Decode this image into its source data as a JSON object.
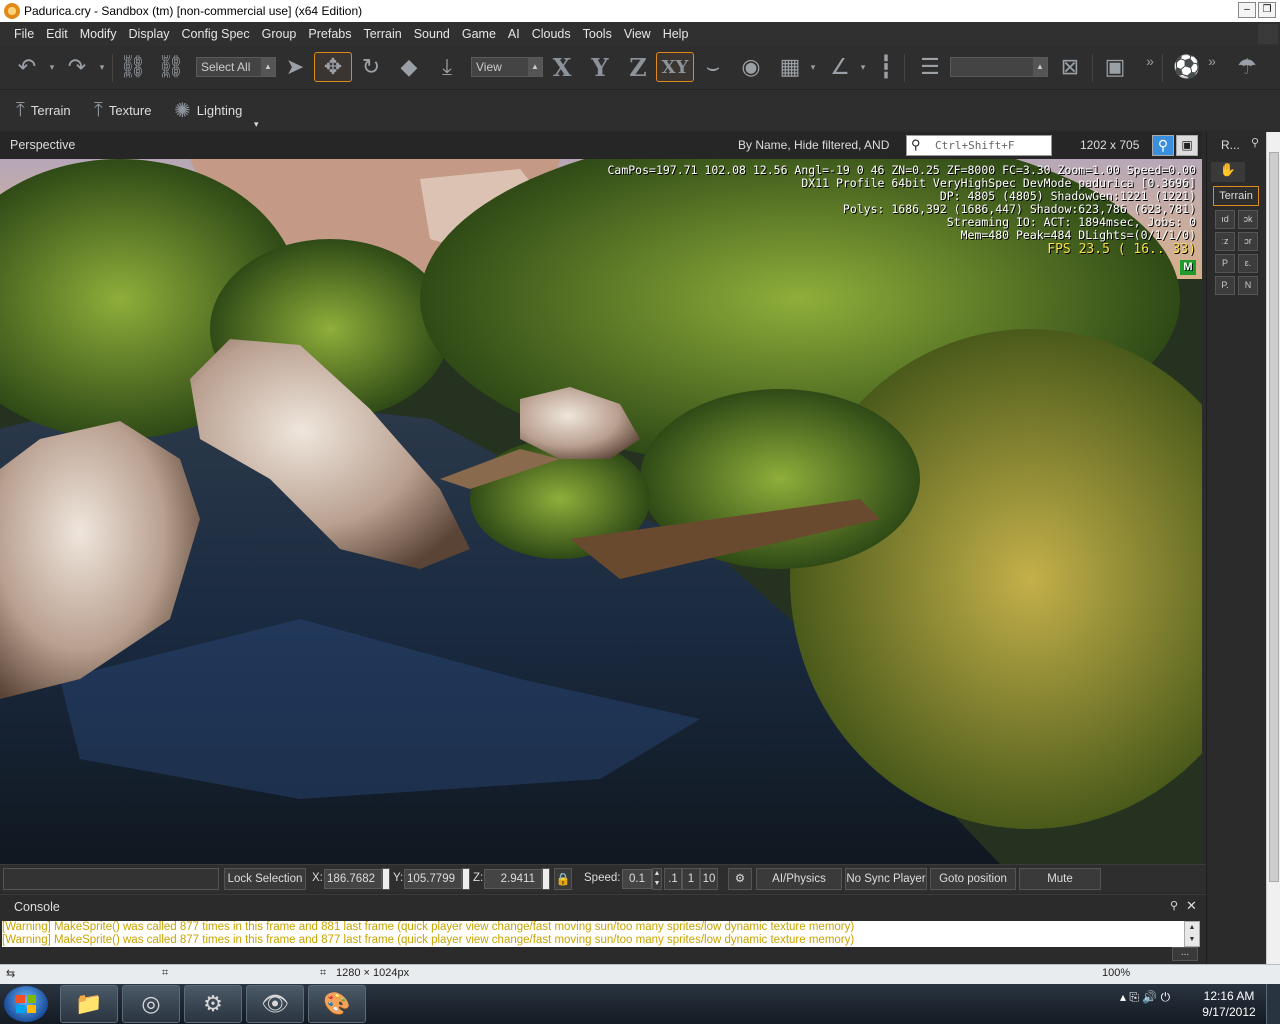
{
  "window": {
    "title": "Padurica.cry - Sandbox (tm) [non-commercial use] (x64 Edition)",
    "min_label": "–",
    "max_label": "❐",
    "close_label": "✕"
  },
  "menu": [
    "File",
    "Edit",
    "Modify",
    "Display",
    "Config Spec",
    "Group",
    "Prefabs",
    "Terrain",
    "Sound",
    "Game",
    "AI",
    "Clouds",
    "Tools",
    "View",
    "Help"
  ],
  "toolbar": {
    "select_value": "Select All",
    "view_value": "View",
    "axis_x": "X",
    "axis_y": "Y",
    "axis_z": "Z",
    "axis_xy": "XY",
    "overflow1": "»",
    "overflow2": "»"
  },
  "toolbar2": {
    "terrain_label": "Terrain",
    "texture_label": "Texture",
    "lighting_label": "Lighting"
  },
  "viewport": {
    "name": "Perspective",
    "filter_label": "By Name, Hide filtered, AND",
    "search_placeholder": "Ctrl+Shift+F",
    "resolution": "1202 x 705"
  },
  "hud": {
    "line1": "CamPos=197.71 102.08 12.56 Angl=-19  0  46 ZN=0.25 ZF=8000 FC=3.30 Zoom=1.00 Speed=0.00",
    "line2": "DX11 Profile 64bit VeryHighSpec DevMode padurica [0.3696]",
    "line3": "DP: 4805 (4805) ShadowGen:1221 (1221)",
    "line4": "Polys: 1686,392 (1686,447) Shadow:623,786 (623,781)",
    "line5": "Streaming IO: ACT: 1894msec, Jobs: 0",
    "line6": "Mem=480 Peak=484 DLights=(0/1/1/0)",
    "fps": "FPS  23.5 ( 16.. 33)",
    "badge": "M"
  },
  "right_panel": {
    "title": "R...",
    "tab": "Terrain",
    "tools": [
      "ıd",
      "ɔk",
      "ːz",
      "ɔr",
      "P",
      "ɛ.",
      "P.",
      "N"
    ]
  },
  "statusbar": {
    "lock_selection": "Lock Selection",
    "x_label": "X:",
    "x_value": "186.7682",
    "y_label": "Y:",
    "y_value": "105.7799",
    "z_label": "Z:",
    "z_value": "2.9411",
    "speed_label": "Speed:",
    "speed_value": "0.1",
    "speed_opt1": ".1",
    "speed_opt2": "1",
    "speed_opt3": "10",
    "ai_physics": "AI/Physics",
    "no_sync_player": "No Sync Player",
    "goto_position": "Goto position",
    "mute": "Mute"
  },
  "console": {
    "title": "Console",
    "lines": [
      "[Warning] MakeSprite() was called 877 times in this frame and 881 last frame (quick player view change/fast moving sun/too many sprites/low dynamic texture memory)",
      "[Warning] MakeSprite() was called 877 times in this frame and 877 last frame (quick player view change/fast moving sun/too many sprites/low dynamic texture memory)"
    ],
    "more": "..."
  },
  "under_strip": {
    "resolution": "1280 × 1024px",
    "zoom": "100%"
  },
  "taskbar": {
    "time": "12:16 AM",
    "date": "9/17/2012"
  },
  "colors": {
    "accent": "#e08a1a",
    "hud_fps": "#f5e04a",
    "warning": "#c8a400",
    "badge": "#1f9a2c"
  }
}
